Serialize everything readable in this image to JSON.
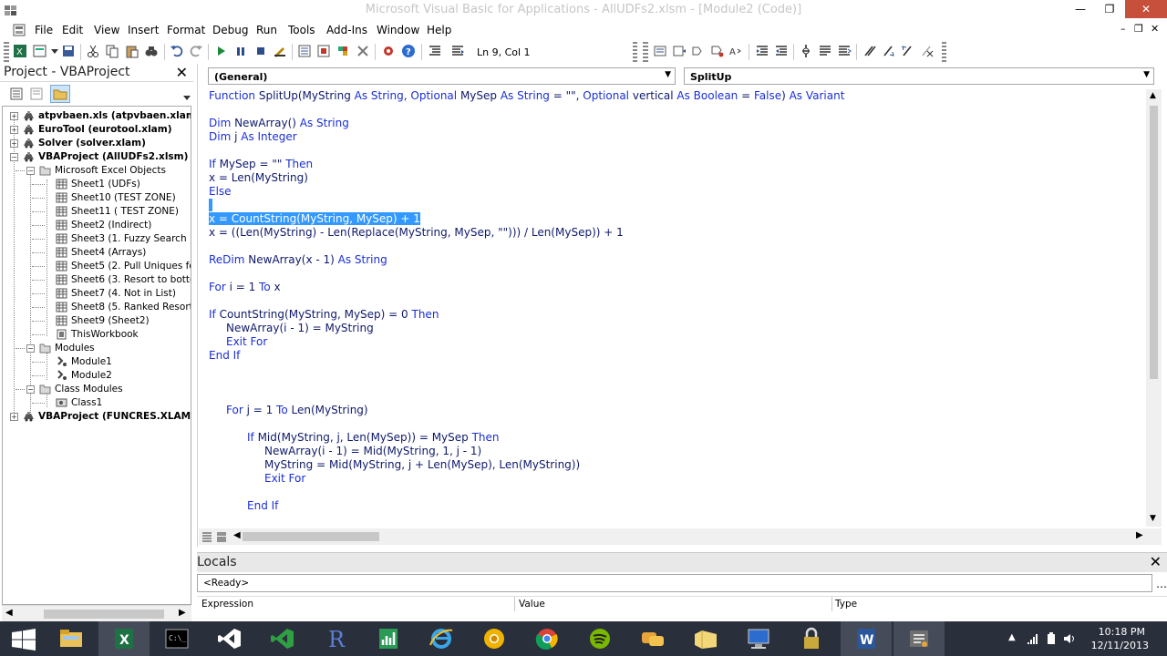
{
  "window": {
    "title": "Microsoft Visual Basic for Applications - AllUDFs2.xlsm - [Module2 (Code)]",
    "minimize": "—",
    "restore": "❐",
    "close": "✕"
  },
  "menu": {
    "items": [
      "File",
      "Edit",
      "View",
      "Insert",
      "Format",
      "Debug",
      "Run",
      "Tools",
      "Add-Ins",
      "Window",
      "Help"
    ],
    "mdi_min": "–",
    "mdi_restore": "❐",
    "mdi_close": "✕"
  },
  "toolbar": {
    "position": "Ln 9, Col 1"
  },
  "project": {
    "title": "Project - VBAProject",
    "close": "✕",
    "tree": [
      {
        "label": "atpvbaen.xls (atpvbaen.xlam)",
        "level": 0,
        "bold": true,
        "expander": "+",
        "icon": "vba-project-icon"
      },
      {
        "label": "EuroTool (eurotool.xlam)",
        "level": 0,
        "bold": true,
        "expander": "+",
        "icon": "vba-project-icon"
      },
      {
        "label": "Solver (solver.xlam)",
        "level": 0,
        "bold": true,
        "expander": "+",
        "icon": "vba-project-icon"
      },
      {
        "label": "VBAProject (AllUDFs2.xlsm)",
        "level": 0,
        "bold": true,
        "expander": "−",
        "icon": "vba-project-icon"
      },
      {
        "label": "Microsoft Excel Objects",
        "level": 1,
        "bold": false,
        "expander": "−",
        "icon": "folder-icon"
      },
      {
        "label": "Sheet1 (UDFs)",
        "level": 2,
        "bold": false,
        "icon": "sheet-icon"
      },
      {
        "label": "Sheet10 (TEST ZONE)",
        "level": 2,
        "bold": false,
        "icon": "sheet-icon"
      },
      {
        "label": "Sheet11 ( TEST ZONE)",
        "level": 2,
        "bold": false,
        "icon": "sheet-icon"
      },
      {
        "label": "Sheet2 (Indirect)",
        "level": 2,
        "bold": false,
        "icon": "sheet-icon"
      },
      {
        "label": "Sheet3 (1. Fuzzy Search )",
        "level": 2,
        "bold": false,
        "icon": "sheet-icon"
      },
      {
        "label": "Sheet4 (Arrays)",
        "level": 2,
        "bold": false,
        "icon": "sheet-icon"
      },
      {
        "label": "Sheet5 (2. Pull Uniques form",
        "level": 2,
        "bold": false,
        "icon": "sheet-icon"
      },
      {
        "label": "Sheet6 (3. Resort to bottom",
        "level": 2,
        "bold": false,
        "icon": "sheet-icon"
      },
      {
        "label": "Sheet7 (4. Not in List)",
        "level": 2,
        "bold": false,
        "icon": "sheet-icon"
      },
      {
        "label": "Sheet8 (5. Ranked Resort)",
        "level": 2,
        "bold": false,
        "icon": "sheet-icon"
      },
      {
        "label": "Sheet9 (Sheet2)",
        "level": 2,
        "bold": false,
        "icon": "sheet-icon"
      },
      {
        "label": "ThisWorkbook",
        "level": 2,
        "bold": false,
        "icon": "workbook-icon"
      },
      {
        "label": "Modules",
        "level": 1,
        "bold": false,
        "expander": "−",
        "icon": "folder-icon"
      },
      {
        "label": "Module1",
        "level": 2,
        "bold": false,
        "icon": "module-icon"
      },
      {
        "label": "Module2",
        "level": 2,
        "bold": false,
        "icon": "module-icon"
      },
      {
        "label": "Class Modules",
        "level": 1,
        "bold": false,
        "expander": "−",
        "icon": "folder-icon"
      },
      {
        "label": "Class1",
        "level": 2,
        "bold": false,
        "icon": "class-module-icon"
      },
      {
        "label": "VBAProject (FUNCRES.XLAM)",
        "level": 0,
        "bold": true,
        "expander": "+",
        "icon": "vba-project-icon"
      }
    ]
  },
  "code_window": {
    "object_combo": "(General)",
    "proc_combo": "SplitUp",
    "lines": [
      {
        "indent": 0,
        "parts": [
          [
            "kw",
            "Function "
          ],
          [
            "",
            "SplitUp(MyString "
          ],
          [
            "kw",
            "As String"
          ],
          [
            "",
            ", "
          ],
          [
            "kw",
            "Optional "
          ],
          [
            "",
            "MySep "
          ],
          [
            "kw",
            "As String"
          ],
          [
            "",
            " = \"\", "
          ],
          [
            "kw",
            "Optional "
          ],
          [
            "",
            "vertical "
          ],
          [
            "kw",
            "As Boolean"
          ],
          [
            "",
            " = "
          ],
          [
            "kw",
            "False"
          ],
          [
            "",
            ") "
          ],
          [
            "kw",
            "As Variant"
          ]
        ]
      },
      {
        "indent": 0,
        "parts": []
      },
      {
        "indent": 0,
        "parts": [
          [
            "kw",
            "Dim "
          ],
          [
            "",
            "NewArray() "
          ],
          [
            "kw",
            "As String"
          ]
        ]
      },
      {
        "indent": 0,
        "parts": [
          [
            "kw",
            "Dim "
          ],
          [
            "",
            "j "
          ],
          [
            "kw",
            "As Integer"
          ]
        ]
      },
      {
        "indent": 0,
        "parts": []
      },
      {
        "indent": 0,
        "parts": [
          [
            "kw",
            "If "
          ],
          [
            "",
            "MySep = \"\" "
          ],
          [
            "kw",
            "Then"
          ]
        ]
      },
      {
        "indent": 0,
        "parts": [
          [
            "",
            "x = Len(MyString)"
          ]
        ]
      },
      {
        "indent": 0,
        "parts": [
          [
            "kw",
            "Else"
          ]
        ]
      },
      {
        "indent": 0,
        "parts": [
          [
            "hl",
            " "
          ]
        ]
      },
      {
        "indent": 0,
        "parts": [
          [
            "hl",
            "x = CountString(MyString, MySep) + 1"
          ]
        ]
      },
      {
        "indent": 0,
        "parts": [
          [
            "",
            "x = ((Len(MyString) - Len(Replace(MyString, MySep, \"\"))) / Len(MySep)) + 1"
          ]
        ]
      },
      {
        "indent": 0,
        "parts": []
      },
      {
        "indent": 0,
        "parts": [
          [
            "kw",
            "ReDim "
          ],
          [
            "",
            "NewArray(x - 1) "
          ],
          [
            "kw",
            "As String"
          ]
        ]
      },
      {
        "indent": 0,
        "parts": []
      },
      {
        "indent": 0,
        "parts": [
          [
            "kw",
            "For "
          ],
          [
            "",
            "i = 1 "
          ],
          [
            "kw",
            "To "
          ],
          [
            "",
            "x"
          ]
        ]
      },
      {
        "indent": 0,
        "parts": []
      },
      {
        "indent": 0,
        "parts": [
          [
            "kw",
            "If "
          ],
          [
            "",
            "CountString(MyString, MySep) = 0 "
          ],
          [
            "kw",
            "Then"
          ]
        ]
      },
      {
        "indent": 1,
        "parts": [
          [
            "",
            "NewArray(i - 1) = MyString"
          ]
        ]
      },
      {
        "indent": 1,
        "parts": [
          [
            "kw",
            "Exit For"
          ]
        ]
      },
      {
        "indent": 0,
        "parts": [
          [
            "kw",
            "End If"
          ]
        ]
      },
      {
        "indent": 0,
        "parts": []
      },
      {
        "indent": 0,
        "parts": []
      },
      {
        "indent": 0,
        "parts": []
      },
      {
        "indent": 1,
        "parts": [
          [
            "kw",
            "For "
          ],
          [
            "",
            "j = 1 "
          ],
          [
            "kw",
            "To "
          ],
          [
            "",
            "Len(MyString)"
          ]
        ]
      },
      {
        "indent": 0,
        "parts": []
      },
      {
        "indent": 2,
        "parts": [
          [
            "kw",
            "If "
          ],
          [
            "",
            "Mid(MyString, j, Len(MySep)) = MySep "
          ],
          [
            "kw",
            "Then"
          ]
        ]
      },
      {
        "indent": 3,
        "parts": [
          [
            "",
            "NewArray(i - 1) = Mid(MyString, 1, j - 1)"
          ]
        ]
      },
      {
        "indent": 3,
        "parts": [
          [
            "",
            "MyString = Mid(MyString, j + Len(MySep), Len(MyString))"
          ]
        ]
      },
      {
        "indent": 3,
        "parts": [
          [
            "kw",
            "Exit For"
          ]
        ]
      },
      {
        "indent": 0,
        "parts": []
      },
      {
        "indent": 2,
        "parts": [
          [
            "kw",
            "End If"
          ]
        ]
      }
    ]
  },
  "locals": {
    "title": "Locals",
    "close": "✕",
    "context": "<Ready>",
    "columns": [
      "Expression",
      "Value",
      "Type"
    ]
  },
  "taskbar": {
    "apps": [
      "windows-explorer",
      "excel",
      "command-prompt",
      "visual-studio",
      "visual-studio-express",
      "r",
      "excel-vba",
      "internet-explorer",
      "chrome-canary",
      "chrome",
      "spotify",
      "lync",
      "onedrive",
      "remote-desktop",
      "keepass",
      "word",
      "vba-editor"
    ],
    "time": "10:18 PM",
    "date": "12/11/2013"
  },
  "colors": {
    "keyword": "#1a2fd6",
    "text": "#0f1a6b",
    "selection": "#3399ff",
    "taskbar": "#2a2f3c"
  }
}
